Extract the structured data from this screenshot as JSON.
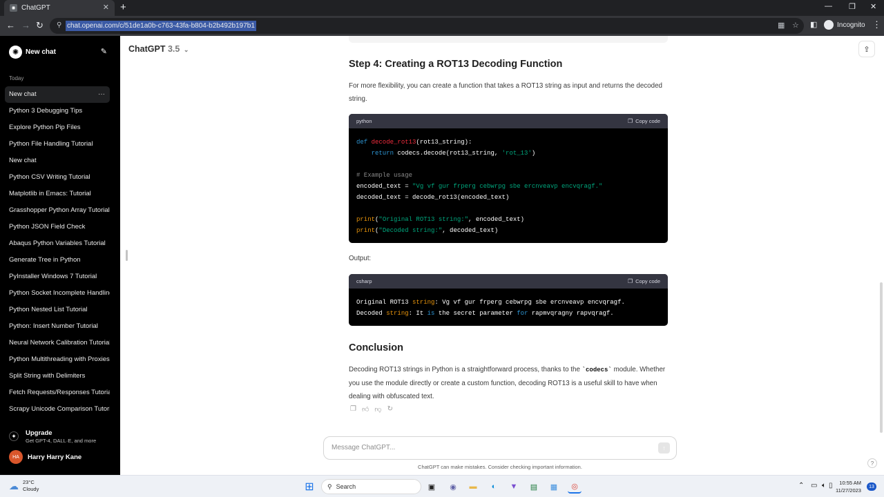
{
  "browser": {
    "tab_title": "ChatGPT",
    "tab_close": "✕",
    "new_tab": "+",
    "win_min": "—",
    "win_max": "❐",
    "win_close": "✕",
    "back": "←",
    "forward": "→",
    "reload": "↻",
    "url": "chat.openai.com/c/51de1a0b-c763-43fa-b804-b2b492b197b1",
    "incognito_label": "Incognito",
    "menu": "⋮"
  },
  "sidebar": {
    "new_chat": "New chat",
    "section": "Today",
    "items": [
      {
        "label": "New chat"
      },
      {
        "label": "Python 3 Debugging Tips"
      },
      {
        "label": "Explore Python Pip Files"
      },
      {
        "label": "Python File Handling Tutorial"
      },
      {
        "label": "New chat"
      },
      {
        "label": "Python CSV Writing Tutorial"
      },
      {
        "label": "Matplotlib in Emacs: Tutorial"
      },
      {
        "label": "Grasshopper Python Array Tutorial"
      },
      {
        "label": "Python JSON Field Check"
      },
      {
        "label": "Abaqus Python Variables Tutorial"
      },
      {
        "label": "Generate Tree in Python"
      },
      {
        "label": "PyInstaller Windows 7 Tutorial"
      },
      {
        "label": "Python Socket Incomplete Handling"
      },
      {
        "label": "Python Nested List Tutorial"
      },
      {
        "label": "Python: Insert Number Tutorial"
      },
      {
        "label": "Neural Network Calibration Tutorial"
      },
      {
        "label": "Python Multithreading with Proxies"
      },
      {
        "label": "Split String with Delimiters"
      },
      {
        "label": "Fetch Requests/Responses Tutorial"
      },
      {
        "label": "Scrapy Unicode Comparison Tutorial"
      }
    ],
    "item_menu": "···",
    "upgrade_title": "Upgrade",
    "upgrade_sub": "Get GPT-4, DALL·E, and more",
    "user_initials": "HA",
    "user_name": "Harry Harry Kane"
  },
  "header": {
    "model": "ChatGPT",
    "version": "3.5",
    "chevron": "⌄"
  },
  "content": {
    "step4_title": "Step 4: Creating a ROT13 Decoding Function",
    "step4_para": "For more flexibility, you can create a function that takes a ROT13 string as input and returns the decoded string.",
    "code1_lang": "python",
    "copy_label": "Copy code",
    "code1_lines": [
      [
        {
          "t": "def ",
          "c": "kw"
        },
        {
          "t": "decode_rot13",
          "c": "fn"
        },
        {
          "t": "(rot13_string):",
          "c": ""
        }
      ],
      [
        {
          "t": "    ",
          "c": ""
        },
        {
          "t": "return",
          "c": "kw"
        },
        {
          "t": " codecs.decode(rot13_string, ",
          "c": ""
        },
        {
          "t": "'rot_13'",
          "c": "str"
        },
        {
          "t": ")",
          "c": ""
        }
      ],
      [],
      [
        {
          "t": "# Example usage",
          "c": "cm"
        }
      ],
      [
        {
          "t": "encoded_text = ",
          "c": ""
        },
        {
          "t": "\"Vg vf gur frperg cebwrpg sbe ercnveavp encvqragf.\"",
          "c": "str"
        }
      ],
      [
        {
          "t": "decoded_text = decode_rot13(encoded_text)",
          "c": ""
        }
      ],
      [],
      [
        {
          "t": "print",
          "c": "bi"
        },
        {
          "t": "(",
          "c": ""
        },
        {
          "t": "\"Original ROT13 string:\"",
          "c": "str"
        },
        {
          "t": ", encoded_text)",
          "c": ""
        }
      ],
      [
        {
          "t": "print",
          "c": "bi"
        },
        {
          "t": "(",
          "c": ""
        },
        {
          "t": "\"Decoded string:\"",
          "c": "str"
        },
        {
          "t": ", decoded_text)",
          "c": ""
        }
      ]
    ],
    "output_label": "Output:",
    "code2_lang": "csharp",
    "code2_lines": [
      [
        {
          "t": "Original ROT13 ",
          "c": ""
        },
        {
          "t": "string",
          "c": "bi"
        },
        {
          "t": ": Vg vf gur frperg cebwrpg sbe ercnveavp encvqragf.",
          "c": ""
        }
      ],
      [
        {
          "t": "Decoded ",
          "c": ""
        },
        {
          "t": "string",
          "c": "bi"
        },
        {
          "t": ": It ",
          "c": ""
        },
        {
          "t": "is",
          "c": "kw"
        },
        {
          "t": " the secret parameter ",
          "c": ""
        },
        {
          "t": "for",
          "c": "kw"
        },
        {
          "t": " rapmvqragny rapvqragf.",
          "c": ""
        }
      ]
    ],
    "conclusion_title": "Conclusion",
    "conclusion_before": "Decoding ROT13 strings in Python is a straightforward process, thanks to the ",
    "conclusion_code": "`codecs`",
    "conclusion_after": " module. Whether you use the module directly or create a custom function, decoding ROT13 is a useful skill to have when dealing with obfuscated text."
  },
  "composer": {
    "placeholder": "Message ChatGPT...",
    "send": "↑",
    "disclaimer": "ChatGPT can make mistakes. Consider checking important information.",
    "help": "?"
  },
  "taskbar": {
    "temp": "23°C",
    "condition": "Cloudy",
    "search": "Search",
    "time": "10:55 AM",
    "date": "11/27/2023",
    "notifications": "13"
  },
  "colors": {
    "sidebar_bg": "#000000",
    "code_bg": "#000000",
    "code_header": "#343541",
    "avatar": "#d9562b"
  }
}
